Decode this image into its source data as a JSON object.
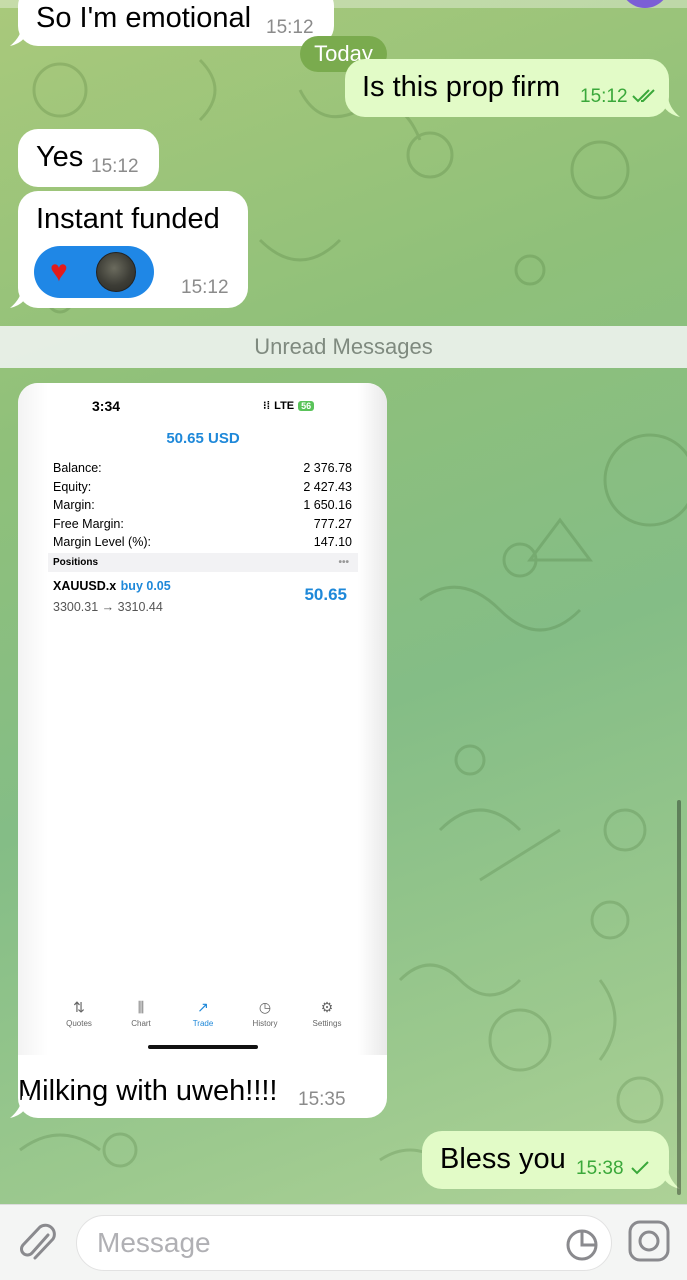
{
  "chat": {
    "date_divider": "Today",
    "unread_divider": "Unread Messages",
    "messages": [
      {
        "text": "So I'm emotional",
        "time": "15:12"
      },
      {
        "text": "Is this prop firm",
        "time": "15:12"
      },
      {
        "text": "Yes",
        "time": "15:12"
      },
      {
        "text": "Instant funded",
        "time": "15:12"
      },
      {
        "text": "Milking with uweh!!!!",
        "time": "15:35"
      },
      {
        "text": "Bless you",
        "time": "15:38"
      }
    ],
    "reactions": [
      {
        "icon": "heart-icon"
      },
      {
        "icon": "avatar"
      }
    ],
    "read_status": [
      "double-check-icon",
      "single-check-icon"
    ]
  },
  "screenshot": {
    "status_time": "3:34",
    "status_network": "LTE",
    "status_battery": "56",
    "balance_header": "50.65 USD",
    "rows": [
      {
        "label": "Balance:",
        "value": "2 376.78"
      },
      {
        "label": "Equity:",
        "value": "2 427.43"
      },
      {
        "label": "Margin:",
        "value": "1 650.16"
      },
      {
        "label": "Free Margin:",
        "value": "777.27"
      },
      {
        "label": "Margin Level (%):",
        "value": "147.10"
      }
    ],
    "positions_label": "Positions",
    "positions_more": "•••",
    "position": {
      "symbol": "XAUUSD.x",
      "direction": "buy 0.05",
      "prices": "3300.31 → 3310.44",
      "profit": "50.65"
    },
    "tabs": [
      {
        "label": "Quotes",
        "icon": "⇅"
      },
      {
        "label": "Chart",
        "icon": "⫼"
      },
      {
        "label": "Trade",
        "icon": "↗"
      },
      {
        "label": "History",
        "icon": "◷"
      },
      {
        "label": "Settings",
        "icon": "⚙"
      }
    ]
  },
  "input": {
    "placeholder": "Message"
  },
  "colors": {
    "outgoing_bubble": "#e2fbc7",
    "incoming_bubble": "#ffffff",
    "accent_blue": "#1e88d9",
    "check_green": "#3aa83a"
  }
}
